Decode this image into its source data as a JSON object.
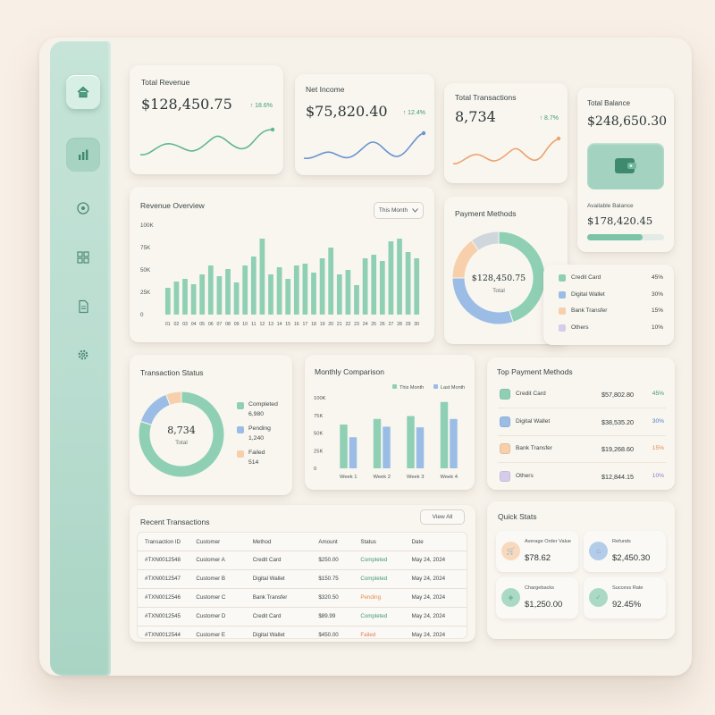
{
  "sidebar": {
    "items": [
      {
        "icon": "home-icon",
        "label": "Home"
      },
      {
        "icon": "bar-chart-icon",
        "label": "Analytics"
      },
      {
        "icon": "target-icon",
        "label": "Goals"
      },
      {
        "icon": "grid-icon",
        "label": "Apps"
      },
      {
        "icon": "document-icon",
        "label": "Reports"
      },
      {
        "icon": "gear-icon",
        "label": "Settings"
      }
    ]
  },
  "kpis": {
    "revenue": {
      "label": "Total Revenue",
      "value": "$128,450.75",
      "delta": "↑ 18.6%"
    },
    "net_income": {
      "label": "Net Income",
      "value": "$75,820.40",
      "delta": "↑ 12.4%"
    },
    "transactions": {
      "label": "Total Transactions",
      "value": "8,734",
      "delta": "↑ 8.7%"
    },
    "balance": {
      "label": "Total Balance",
      "value": "$248,650.30",
      "available_label": "Available Balance",
      "available_value": "$178,420.45",
      "available_fraction": 0.72
    }
  },
  "colors": {
    "green": "#8fd0b5",
    "blue": "#9bbde5",
    "peach": "#f7cfaa",
    "purple": "#d3cdeb",
    "grey": "#cfd6dc",
    "accent": "#3e9a74"
  },
  "revenue_overview": {
    "title": "Revenue Overview",
    "period": "This Month",
    "chart_data": {
      "type": "bar",
      "title": "Revenue Overview",
      "ylim": [
        0,
        100000
      ],
      "yticks": [
        "100K",
        "75K",
        "50K",
        "25K",
        "0"
      ],
      "xtick_labels": [
        "01",
        "02",
        "03",
        "04",
        "05",
        "06",
        "07",
        "08",
        "09",
        "10",
        "11",
        "12",
        "13",
        "14",
        "15",
        "16",
        "17",
        "18",
        "19",
        "20",
        "21",
        "22",
        "23",
        "24",
        "25",
        "26",
        "27",
        "28",
        "29",
        "30"
      ],
      "categories": [
        "01",
        "02",
        "03",
        "04",
        "05",
        "06",
        "07",
        "08",
        "09",
        "10",
        "11",
        "12",
        "13",
        "14",
        "15",
        "16",
        "17",
        "18",
        "19",
        "20",
        "21",
        "22",
        "23",
        "24",
        "25",
        "26",
        "27",
        "28",
        "29",
        "30"
      ],
      "values": [
        30000,
        37000,
        40000,
        34000,
        45000,
        55000,
        43000,
        51000,
        36000,
        55000,
        65000,
        85000,
        45000,
        53000,
        40000,
        55000,
        57000,
        47000,
        63000,
        75000,
        45000,
        50000,
        33000,
        63000,
        67000,
        60000,
        82000,
        85000,
        70000,
        63000
      ]
    }
  },
  "payment_methods": {
    "title": "Payment Methods",
    "center_value": "$128,450.75",
    "center_label": "Total",
    "chart_data": {
      "type": "pie",
      "labels": [
        "Credit Card",
        "Digital Wallet",
        "Bank Transfer",
        "Others"
      ],
      "values": [
        45,
        30,
        15,
        10
      ],
      "value_labels": [
        "45%",
        "30%",
        "15%",
        "10%"
      ]
    }
  },
  "transaction_status": {
    "title": "Transaction Status",
    "center_value": "8,734",
    "center_label": "Total",
    "chart_data": {
      "type": "pie",
      "labels": [
        "Completed",
        "Pending",
        "Failed"
      ],
      "values": [
        6980,
        1240,
        514
      ],
      "value_labels": [
        "6,980",
        "1,240",
        "514"
      ]
    }
  },
  "monthly_comparison": {
    "title": "Monthly Comparison",
    "chart_data": {
      "type": "bar",
      "title": "Monthly Comparison",
      "categories": [
        "Week 1",
        "Week 2",
        "Week 3",
        "Week 4"
      ],
      "series": [
        {
          "name": "This Month",
          "values": [
            62000,
            70000,
            74000,
            94000
          ]
        },
        {
          "name": "Last Month",
          "values": [
            44000,
            59000,
            58000,
            70000
          ]
        }
      ],
      "ylim": [
        0,
        100000
      ],
      "yticks": [
        "100K",
        "75K",
        "50K",
        "25K",
        "0"
      ]
    }
  },
  "top_payment_methods": {
    "title": "Top Payment Methods",
    "rows": [
      {
        "name": "Credit Card",
        "amount": "$57,802.80",
        "pct": "45%"
      },
      {
        "name": "Digital Wallet",
        "amount": "$38,535.20",
        "pct": "30%"
      },
      {
        "name": "Bank Transfer",
        "amount": "$19,268.60",
        "pct": "15%"
      },
      {
        "name": "Others",
        "amount": "$12,844.15",
        "pct": "10%"
      }
    ]
  },
  "recent_transactions": {
    "title": "Recent Transactions",
    "view_all": "View All",
    "columns": [
      "Transaction ID",
      "Customer",
      "Method",
      "Amount",
      "Status",
      "Date"
    ],
    "rows": [
      [
        "#TXN0012548",
        "Customer A",
        "Credit Card",
        "$250.00",
        "Completed",
        "May 24, 2024"
      ],
      [
        "#TXN0012547",
        "Customer B",
        "Digital Wallet",
        "$150.75",
        "Completed",
        "May 24, 2024"
      ],
      [
        "#TXN0012546",
        "Customer C",
        "Bank Transfer",
        "$320.50",
        "Pending",
        "May 24, 2024"
      ],
      [
        "#TXN0012545",
        "Customer D",
        "Credit Card",
        "$89.99",
        "Completed",
        "May 24, 2024"
      ],
      [
        "#TXN0012544",
        "Customer E",
        "Digital Wallet",
        "$450.00",
        "Failed",
        "May 24, 2024"
      ]
    ]
  },
  "quick_stats": {
    "title": "Quick Stats",
    "items": [
      {
        "label": "Average Order Value",
        "value": "$78.62"
      },
      {
        "label": "Refunds",
        "value": "$2,450.30"
      },
      {
        "label": "Chargebacks",
        "value": "$1,250.00"
      },
      {
        "label": "Success Rate",
        "value": "92.45%"
      }
    ]
  }
}
